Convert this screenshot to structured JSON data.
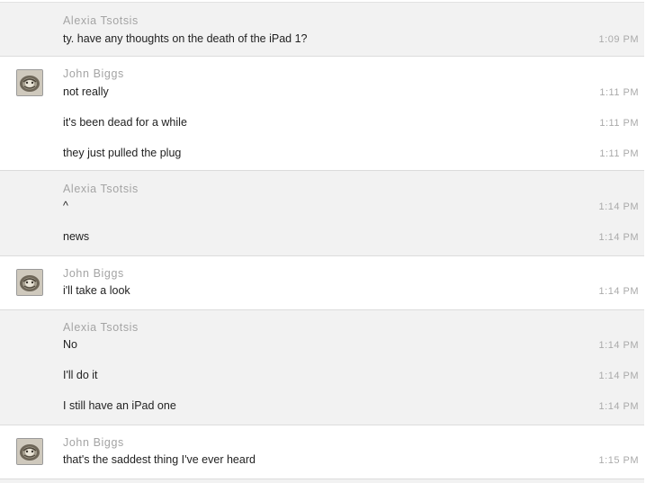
{
  "conversation": {
    "groups": [
      {
        "sender": "Alexia Tsotsis",
        "has_avatar": false,
        "messages": [
          {
            "text": "ty. have any thoughts on the death of the iPad 1?",
            "time": "1:09 PM"
          }
        ]
      },
      {
        "sender": "John Biggs",
        "has_avatar": true,
        "avatar_icon": "avatar-photo-icon",
        "messages": [
          {
            "text": "not really",
            "time": "1:11 PM"
          },
          {
            "text": "it's been dead for a while",
            "time": "1:11 PM"
          },
          {
            "text": "they just pulled the plug",
            "time": "1:11 PM"
          }
        ]
      },
      {
        "sender": "Alexia Tsotsis",
        "has_avatar": false,
        "messages": [
          {
            "text": "^",
            "time": "1:14 PM"
          },
          {
            "text": "news",
            "time": "1:14 PM"
          }
        ]
      },
      {
        "sender": "John Biggs",
        "has_avatar": true,
        "avatar_icon": "avatar-photo-icon",
        "messages": [
          {
            "text": "i'll take a look",
            "time": "1:14 PM"
          }
        ]
      },
      {
        "sender": "Alexia Tsotsis",
        "has_avatar": false,
        "messages": [
          {
            "text": "No",
            "time": "1:14 PM"
          },
          {
            "text": "I'll do it",
            "time": "1:14 PM"
          },
          {
            "text": "I still have an iPad one",
            "time": "1:14 PM"
          }
        ]
      },
      {
        "sender": "John Biggs",
        "has_avatar": true,
        "avatar_icon": "avatar-photo-icon",
        "messages": [
          {
            "text": "that's the saddest thing I've ever heard",
            "time": "1:15 PM"
          }
        ]
      }
    ]
  },
  "colors": {
    "alt_row_background": "#f2f2f2",
    "row_background": "#ffffff",
    "sender_text": "#a4a4a4",
    "message_text": "#222222",
    "timestamp_text": "#aaaaaa",
    "divider": "#dcdcdc"
  }
}
